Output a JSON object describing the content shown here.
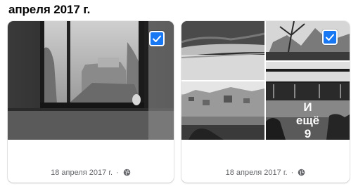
{
  "heading": "апреля 2017 г.",
  "albums": [
    {
      "date": "18 апреля 2017 г.",
      "separator": "·",
      "privacy_icon": "globe-icon",
      "selected": true
    },
    {
      "date": "18 апреля 2017 г.",
      "separator": "·",
      "privacy_icon": "globe-icon",
      "selected": true,
      "more_overlay": [
        "И",
        "ещё",
        "9"
      ]
    }
  ],
  "colors": {
    "checkbox": "#1877f2",
    "caption": "#65676b"
  }
}
